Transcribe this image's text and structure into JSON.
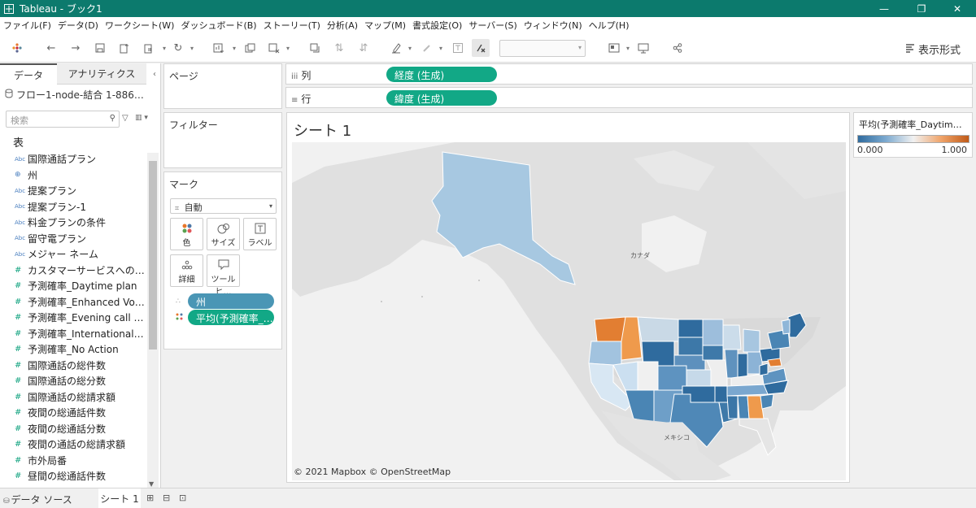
{
  "window": {
    "title": "Tableau - ブック1",
    "minimize_glyph": "—",
    "restore_glyph": "❐",
    "close_glyph": "✕"
  },
  "menubar": [
    "ファイル(F)",
    "データ(D)",
    "ワークシート(W)",
    "ダッシュボード(B)",
    "ストーリー(T)",
    "分析(A)",
    "マップ(M)",
    "書式設定(O)",
    "サーバー(S)",
    "ウィンドウ(N)",
    "ヘルプ(H)"
  ],
  "toolbar": {
    "show_me_label": "表示形式"
  },
  "data_pane": {
    "tabs": [
      "データ",
      "アナリティクス"
    ],
    "collapse_glyph": "‹",
    "datasource": "フロー1-node-結合 1-886…",
    "search_placeholder": "検索",
    "tables_heading": "表",
    "fields": [
      {
        "type": "Abc",
        "name": "国際通話プラン",
        "kind": "dim"
      },
      {
        "type": "⊕",
        "name": "州",
        "kind": "geo"
      },
      {
        "type": "Abc",
        "name": "提案プラン",
        "kind": "dim"
      },
      {
        "type": "Abc",
        "name": "提案プラン-1",
        "kind": "dim"
      },
      {
        "type": "Abc",
        "name": "料金プランの条件",
        "kind": "dim"
      },
      {
        "type": "Abc",
        "name": "留守電プラン",
        "kind": "dim"
      },
      {
        "type": "Abc",
        "name": "メジャー ネーム",
        "kind": "dim"
      },
      {
        "type": "#",
        "name": "カスタマーサービスへの電話…",
        "kind": "num"
      },
      {
        "type": "#",
        "name": "予測確率_Daytime plan",
        "kind": "num"
      },
      {
        "type": "#",
        "name": "予測確率_Enhanced Voi…",
        "kind": "num"
      },
      {
        "type": "#",
        "name": "予測確率_Evening call …",
        "kind": "num"
      },
      {
        "type": "#",
        "name": "予測確率_International…",
        "kind": "num"
      },
      {
        "type": "#",
        "name": "予測確率_No Action",
        "kind": "num"
      },
      {
        "type": "#",
        "name": "国際通話の総件数",
        "kind": "num"
      },
      {
        "type": "#",
        "name": "国際通話の総分数",
        "kind": "num"
      },
      {
        "type": "#",
        "name": "国際通話の総請求額",
        "kind": "num"
      },
      {
        "type": "#",
        "name": "夜間の総通話件数",
        "kind": "num"
      },
      {
        "type": "#",
        "name": "夜間の総通話分数",
        "kind": "num"
      },
      {
        "type": "#",
        "name": "夜間の通話の総請求額",
        "kind": "num"
      },
      {
        "type": "#",
        "name": "市外局番",
        "kind": "num"
      },
      {
        "type": "#",
        "name": "昼間の総通話件数",
        "kind": "num"
      }
    ]
  },
  "pages_card": {
    "title": "ページ"
  },
  "filters_card": {
    "title": "フィルター"
  },
  "marks_card": {
    "title": "マーク",
    "mark_type": "自動",
    "buttons": [
      {
        "label": "色",
        "icon": "color-icon"
      },
      {
        "label": "サイズ",
        "icon": "size-icon"
      },
      {
        "label": "ラベル",
        "icon": "label-icon"
      },
      {
        "label": "詳細",
        "icon": "detail-icon"
      },
      {
        "label": "ツールヒ…",
        "icon": "tooltip-icon"
      }
    ],
    "pills": [
      {
        "label": "州",
        "color": "#4a96b5"
      },
      {
        "label": "平均(予測確率_…",
        "color": "#12a886"
      }
    ]
  },
  "columns_shelf": {
    "label": "列",
    "pill": "経度 (生成)"
  },
  "rows_shelf": {
    "label": "行",
    "pill": "緯度 (生成)"
  },
  "sheet": {
    "title": "シート 1",
    "map_labels": {
      "canada": "カナダ",
      "mexico": "メキシコ"
    },
    "credit": "© 2021 Mapbox © OpenStreetMap"
  },
  "legend": {
    "title": "平均(予測確率_Daytim…",
    "min": "0.000",
    "max": "1.000",
    "colors": [
      "#2f6b9e",
      "#7ba9cf",
      "#f1f1f1",
      "#f0a46a",
      "#c05a18"
    ]
  },
  "bottom_tabs": {
    "datasource": "データ ソース",
    "sheet": "シート 1"
  },
  "colors": {
    "titlebar": "#0c7a6d",
    "pill_green": "#12a886",
    "pill_blue": "#4a96b5"
  }
}
